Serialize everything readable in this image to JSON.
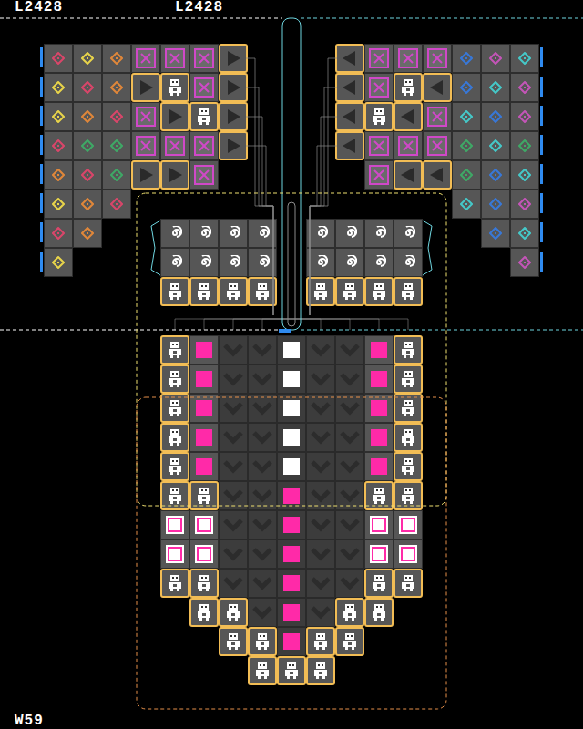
{
  "hud": {
    "left_counter": "L2428",
    "center_counter": "L2428",
    "bottom_counter": "W59"
  },
  "board": {
    "legend": {
      "r": {
        "kind": "gem",
        "color": "#d9466a",
        "outlined": false
      },
      "y": {
        "kind": "gem",
        "color": "#e8d44a",
        "outlined": false
      },
      "o": {
        "kind": "gem",
        "color": "#e0873a",
        "outlined": false
      },
      "g": {
        "kind": "gem",
        "color": "#3fa866",
        "outlined": false
      },
      "b": {
        "kind": "gem",
        "color": "#3878d8",
        "outlined": false
      },
      "m": {
        "kind": "gem",
        "color": "#c455b8",
        "outlined": false
      },
      "c": {
        "kind": "gem",
        "color": "#45c8c8",
        "outlined": false
      },
      "X": {
        "kind": "crate",
        "color": "#d048c8",
        "outlined": false
      },
      "R": {
        "kind": "arrow-right",
        "color": "#2a2a2a",
        "outlined": true
      },
      "L": {
        "kind": "arrow-left",
        "color": "#2a2a2a",
        "outlined": true
      },
      "B": {
        "kind": "robot",
        "color": "#ffffff",
        "outlined": true
      },
      "S": {
        "kind": "swirl",
        "color": "#ffffff",
        "outlined": false
      },
      "P": {
        "kind": "pink-block",
        "color": "#ff2aa8",
        "outlined": false
      },
      "W": {
        "kind": "white-block",
        "color": "#ffffff",
        "outlined": false
      },
      "M": {
        "kind": "magenta-block",
        "color": "#ff2aa8",
        "outlined": false
      },
      "H": {
        "kind": "hollow-block",
        "color": "#ff2aa8",
        "outlined": false
      },
      "V": {
        "kind": "chevron",
        "color": "#2c2c2c",
        "outlined": false
      }
    },
    "rows": [
      "ryoXXXR...LXXXbmc",
      "yroRBXR...LXBLbcm",
      "yorXRBR...LBLXcbm",
      "rggXXXR...LXXXgcg",
      "orgRRX.....XLLgbc",
      "yor...........cbm",
      "ro..SSSS.SSSS..bc",
      "y...SSSS.SSSS...m",
      "....BBBB.BBBB....",
      ".................",
      "....BPVVWVVPB....",
      "....BPVVWVVPB....",
      "....BPVVWVVPB....",
      "....BPVVWVVPB....",
      "....BPVVWVVPB....",
      "....BBVVMVVBB....",
      "....HHVVMVVHH....",
      "....HHVVMVVHH....",
      "....BBVVMVVBB....",
      ".....BBVMVBB.....",
      "......BBMBB......",
      ".......BBB......."
    ]
  }
}
